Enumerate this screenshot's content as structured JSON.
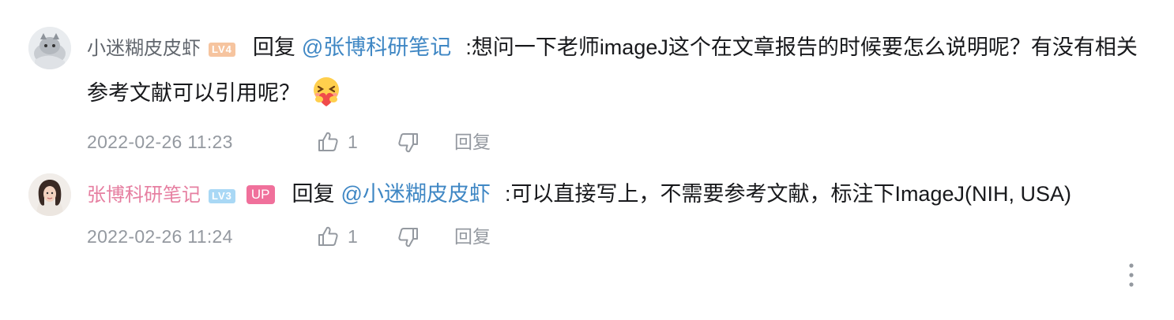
{
  "comments": [
    {
      "username": "小迷糊皮皮虾",
      "level": "LV4",
      "reply_label": "回复",
      "mention": "@张博科研笔记",
      "text": ":想问一下老师imageJ这个在文章报告的时候要怎么说明呢？有没有相关参考文献可以引用呢？",
      "emoji": "hug-emoji",
      "time": "2022-02-26 11:23",
      "likes": "1",
      "reply_button": "回复"
    },
    {
      "username": "张博科研笔记",
      "level": "LV3",
      "badge": "UP",
      "reply_label": "回复",
      "mention": "@小迷糊皮皮虾",
      "text": ":可以直接写上，不需要参考文献，标注下ImageJ(NIH, USA)",
      "time": "2022-02-26 11:24",
      "likes": "1",
      "reply_button": "回复"
    }
  ],
  "colors": {
    "username": "#61666d",
    "up_username": "#e67fa1",
    "mention": "#3f87c4",
    "meta": "#9499a0",
    "level4_badge": "#f6c49f",
    "level3_badge": "#a9d8f5",
    "up_badge": "#f0709b"
  },
  "icons": [
    "thumbs-up-icon",
    "thumbs-down-icon",
    "more-vertical-icon"
  ]
}
